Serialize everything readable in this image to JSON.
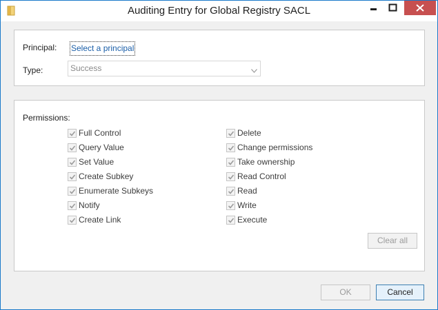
{
  "window": {
    "title": "Auditing Entry for Global Registry SACL"
  },
  "principal": {
    "label": "Principal:",
    "link": "Select a principal"
  },
  "type": {
    "label": "Type:",
    "value": "Success"
  },
  "permissions": {
    "label": "Permissions:",
    "left": [
      {
        "label": "Full Control",
        "checked": true
      },
      {
        "label": "Query Value",
        "checked": true
      },
      {
        "label": "Set Value",
        "checked": true
      },
      {
        "label": "Create Subkey",
        "checked": true
      },
      {
        "label": "Enumerate Subkeys",
        "checked": true
      },
      {
        "label": "Notify",
        "checked": true
      },
      {
        "label": "Create Link",
        "checked": true
      }
    ],
    "right": [
      {
        "label": "Delete",
        "checked": true
      },
      {
        "label": "Change permissions",
        "checked": true
      },
      {
        "label": "Take ownership",
        "checked": true
      },
      {
        "label": "Read Control",
        "checked": true
      },
      {
        "label": "Read",
        "checked": true
      },
      {
        "label": "Write",
        "checked": true
      },
      {
        "label": "Execute",
        "checked": true
      }
    ],
    "clear_all": "Clear all"
  },
  "buttons": {
    "ok": "OK",
    "cancel": "Cancel"
  },
  "colors": {
    "window_border": "#1979ca",
    "close_button": "#c75050",
    "link": "#1a5ea8"
  }
}
